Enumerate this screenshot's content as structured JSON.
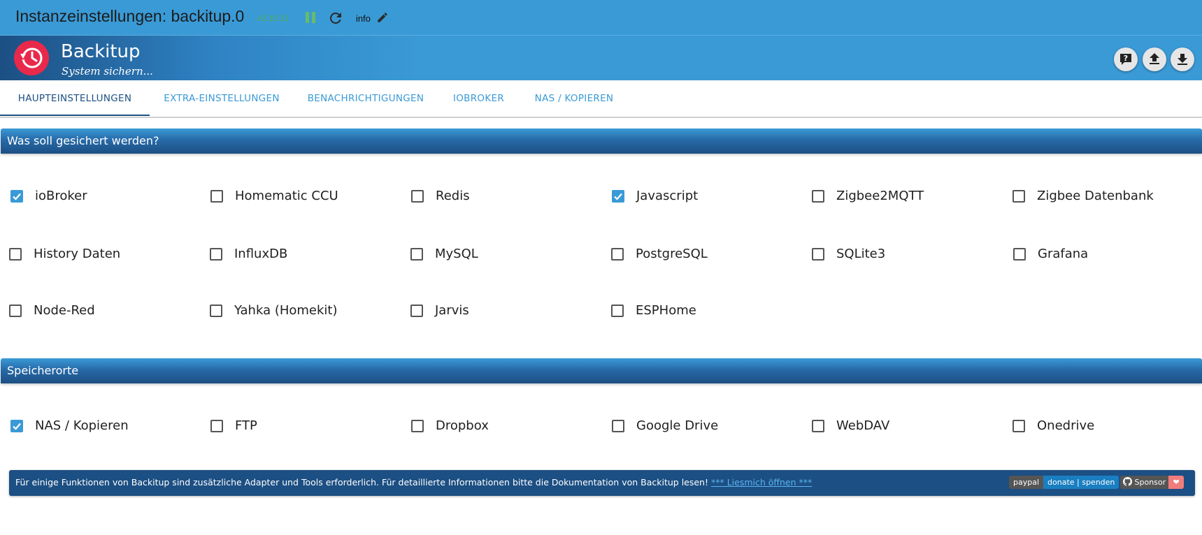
{
  "window": {
    "title": "Instanzeinstellungen: backitup.0",
    "version": "v2.10.11",
    "info_label": "info",
    "icons": [
      "pause-icon",
      "reload-icon",
      "pencil-icon"
    ]
  },
  "header": {
    "app_name": "Backitup",
    "subtitle": "System sichern...",
    "buttons": [
      "help-icon",
      "upload-icon",
      "download-icon"
    ],
    "accent_color": "#3a9ad6",
    "logo_color": "#e8294b"
  },
  "tabs": [
    {
      "label": "HAUPTEINSTELLUNGEN",
      "active": true
    },
    {
      "label": "EXTRA-EINSTELLUNGEN",
      "active": false
    },
    {
      "label": "BENACHRICHTIGUNGEN",
      "active": false
    },
    {
      "label": "IOBROKER",
      "active": false
    },
    {
      "label": "NAS / KOPIEREN",
      "active": false
    }
  ],
  "sections": {
    "backup": {
      "title": "Was soll gesichert werden?",
      "items": [
        {
          "label": "ioBroker",
          "checked": true
        },
        {
          "label": "Homematic CCU",
          "checked": false
        },
        {
          "label": "Redis",
          "checked": false
        },
        {
          "label": "Javascript",
          "checked": true
        },
        {
          "label": "Zigbee2MQTT",
          "checked": false
        },
        {
          "label": "Zigbee Datenbank",
          "checked": false
        },
        {
          "label": "History Daten",
          "checked": false
        },
        {
          "label": "InfluxDB",
          "checked": false
        },
        {
          "label": "MySQL",
          "checked": false
        },
        {
          "label": "PostgreSQL",
          "checked": false
        },
        {
          "label": "SQLite3",
          "checked": false
        },
        {
          "label": "Grafana",
          "checked": false
        },
        {
          "label": "Node-Red",
          "checked": false
        },
        {
          "label": "Yahka (Homekit)",
          "checked": false
        },
        {
          "label": "Jarvis",
          "checked": false
        },
        {
          "label": "ESPHome",
          "checked": false
        }
      ]
    },
    "storage": {
      "title": "Speicherorte",
      "items": [
        {
          "label": "NAS / Kopieren",
          "checked": true
        },
        {
          "label": "FTP",
          "checked": false
        },
        {
          "label": "Dropbox",
          "checked": false
        },
        {
          "label": "Google Drive",
          "checked": false
        },
        {
          "label": "WebDAV",
          "checked": false
        },
        {
          "label": "Onedrive",
          "checked": false
        }
      ]
    }
  },
  "footer": {
    "message": "Für einige Funktionen von Backitup sind zusätzliche Adapter und Tools erforderlich. Für detaillierte Informationen bitte die Dokumentation von Backitup lesen! ",
    "link_text": "*** Liesmich öffnen ***",
    "paypal_left": "paypal",
    "paypal_right": "donate | spenden",
    "sponsor_label": "Sponsor"
  }
}
